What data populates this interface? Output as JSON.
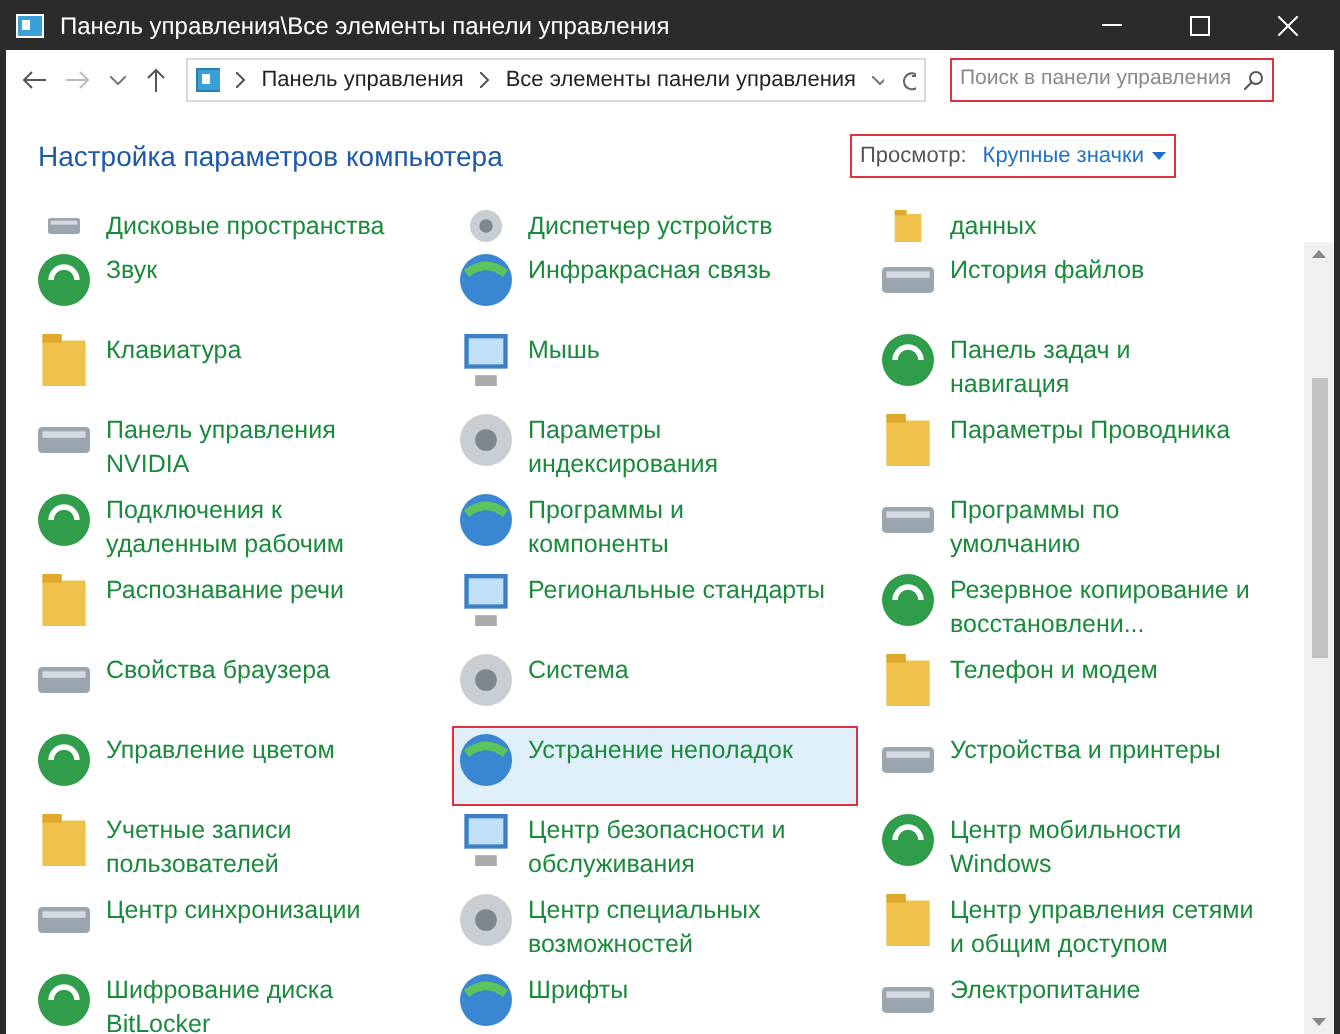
{
  "window": {
    "title": "Панель управления\\Все элементы панели управления"
  },
  "address": {
    "crumbs": [
      "Панель управления",
      "Все элементы панели управления"
    ]
  },
  "search": {
    "placeholder": "Поиск в панели управления",
    "highlighted": true
  },
  "header": {
    "title": "Настройка параметров компьютера",
    "view_label": "Просмотр:",
    "view_value": "Крупные значки",
    "view_highlighted": true
  },
  "items": [
    {
      "label": "Дисковые пространства",
      "selected": false
    },
    {
      "label": "Диспетчер устройств",
      "selected": false
    },
    {
      "label": "данных",
      "selected": false
    },
    {
      "label": "Звук",
      "selected": false
    },
    {
      "label": "Инфракрасная связь",
      "selected": false
    },
    {
      "label": "История файлов",
      "selected": false
    },
    {
      "label": "Клавиатура",
      "selected": false
    },
    {
      "label": "Мышь",
      "selected": false
    },
    {
      "label": "Панель задач и\nнавигация",
      "selected": false
    },
    {
      "label": "Панель управления\nNVIDIA",
      "selected": false
    },
    {
      "label": "Параметры\nиндексирования",
      "selected": false
    },
    {
      "label": "Параметры Проводника",
      "selected": false
    },
    {
      "label": "Подключения к\nудаленным рабочим",
      "selected": false
    },
    {
      "label": "Программы и\nкомпоненты",
      "selected": false
    },
    {
      "label": "Программы по\nумолчанию",
      "selected": false
    },
    {
      "label": "Распознавание речи",
      "selected": false
    },
    {
      "label": "Региональные стандарты",
      "selected": false
    },
    {
      "label": "Резервное копирование и\nвосстановлени...",
      "selected": false
    },
    {
      "label": "Свойства браузера",
      "selected": false
    },
    {
      "label": "Система",
      "selected": false
    },
    {
      "label": "Телефон и модем",
      "selected": false
    },
    {
      "label": "Управление цветом",
      "selected": false
    },
    {
      "label": "Устранение неполадок",
      "selected": true
    },
    {
      "label": "Устройства и принтеры",
      "selected": false
    },
    {
      "label": "Учетные записи\nпользователей",
      "selected": false
    },
    {
      "label": "Центр безопасности и\nобслуживания",
      "selected": false
    },
    {
      "label": "Центр мобильности\nWindows",
      "selected": false
    },
    {
      "label": "Центр синхронизации",
      "selected": false
    },
    {
      "label": "Центр специальных\nвозможностей",
      "selected": false
    },
    {
      "label": "Центр управления сетями\nи общим доступом",
      "selected": false
    },
    {
      "label": "Шифрование диска\nBitLocker",
      "selected": false
    },
    {
      "label": "Шрифты",
      "selected": false
    },
    {
      "label": "Электропитание",
      "selected": false
    }
  ]
}
